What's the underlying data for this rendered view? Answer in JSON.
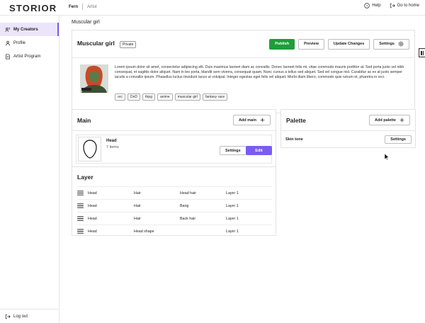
{
  "app": {
    "logo": "STORIOR"
  },
  "breadcrumb": {
    "user": "Fern",
    "role": "Artist"
  },
  "topbar": {
    "help": "Help",
    "home": "Go to home"
  },
  "sidebar": {
    "items": [
      {
        "label": "My Creators",
        "icon": "user-group-icon"
      },
      {
        "label": "Profile",
        "icon": "person-icon"
      },
      {
        "label": "Artist Program",
        "icon": "document-icon"
      }
    ],
    "logout": "Log out"
  },
  "page": {
    "title": "Muscular girl"
  },
  "creator": {
    "name": "Muscular girl",
    "visibility": "Private",
    "buttons": {
      "publish": "Publish",
      "preview": "Preview",
      "update": "Update Changes",
      "settings": "Settings"
    },
    "description": "Lorem ipsum dolor sit amet, consectetur adipiscing elit. Duis maximus laoreet diam ac convallis. Donec laoreet felis mi, vitae commodo mauris porttitor at. Sed porta justo vel nibh consequat, et sagittis dolor aliquet. Nam in leo porta, blandit sem viverra, consequat quam. Nunc cursus a tellus sed aliquet. Sed vel congue nisl. Curabitur ac ex at justo semper iaculis a convallis ipsum. Phasellus luctus tincidunt lacus ut volutpat. Integer egestas eget felis vel aliquet. Morbi diam libero, commodo quis rutrum et, pharetra in orci.",
    "tags": [
      "orc",
      "DnD",
      "ttrpg",
      "anime",
      "muscular girl",
      "fantasy race"
    ]
  },
  "main_section": {
    "title": "Main",
    "add_label": "Add main",
    "item": {
      "name": "Head",
      "count": "7 items",
      "settings": "Settings",
      "edit": "Edit"
    }
  },
  "palette_section": {
    "title": "Palette",
    "add_label": "Add palette",
    "item": {
      "name": "Skin tone",
      "settings": "Settings"
    }
  },
  "layer_section": {
    "title": "Layer",
    "rows": [
      {
        "main": "Head",
        "category": "Hair",
        "name": "Head hair",
        "layer": "Layer 1"
      },
      {
        "main": "Head",
        "category": "Hair",
        "name": "Bang",
        "layer": "Layer 1"
      },
      {
        "main": "Head",
        "category": "Hair",
        "name": "Back hair",
        "layer": "Layer 1"
      },
      {
        "main": "Head",
        "category": "Head shape",
        "name": "",
        "layer": "Layer 1"
      }
    ]
  },
  "colors": {
    "accent": "#7a5cf0",
    "publish": "#1f9d3a",
    "active_nav": "#ebe5fc"
  }
}
